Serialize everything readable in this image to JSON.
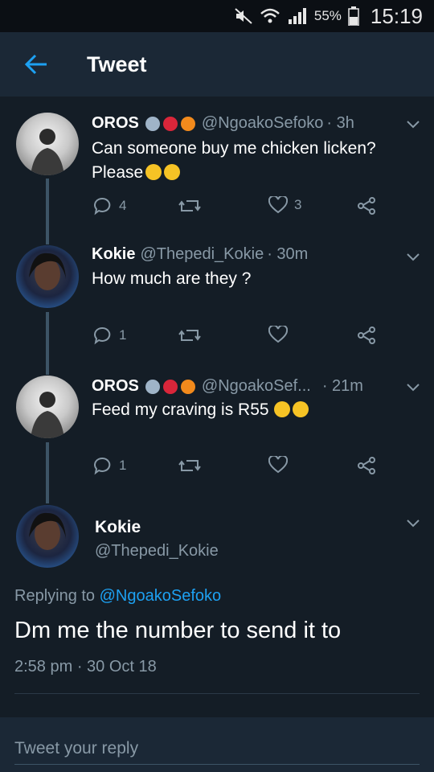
{
  "status_bar": {
    "battery": "55%",
    "time": "15:19"
  },
  "appbar": {
    "title": "Tweet"
  },
  "thread": [
    {
      "name": "OROS",
      "handle": "@NgoakoSefoko",
      "time": "· 3h",
      "text_line1": "Can someone buy me chicken licken?",
      "text_line2": "Please",
      "replies": "4",
      "retweets": "",
      "likes": "3"
    },
    {
      "name": "Kokie",
      "handle": "@Thepedi_Kokie",
      "time": "· 30m",
      "text_line1": "How much are they ?",
      "replies": "1",
      "retweets": "",
      "likes": ""
    },
    {
      "name": "OROS",
      "handle": "@NgoakoSef...",
      "time": "· 21m",
      "text_line1": "Feed my craving is R55",
      "replies": "1",
      "retweets": "",
      "likes": ""
    }
  ],
  "main_tweet": {
    "name": "Kokie",
    "handle": "@Thepedi_Kokie",
    "replying_prefix": "Replying to",
    "replying_to": "@NgoakoSefoko",
    "text": "Dm me the number to send it to",
    "timestamp": "2:58 pm · 30 Oct 18"
  },
  "reply": {
    "placeholder": "Tweet your reply"
  },
  "colors": {
    "background": "#141d26",
    "bar": "#1b2836",
    "secondary_text": "#8899a6",
    "link": "#1da1f2"
  }
}
